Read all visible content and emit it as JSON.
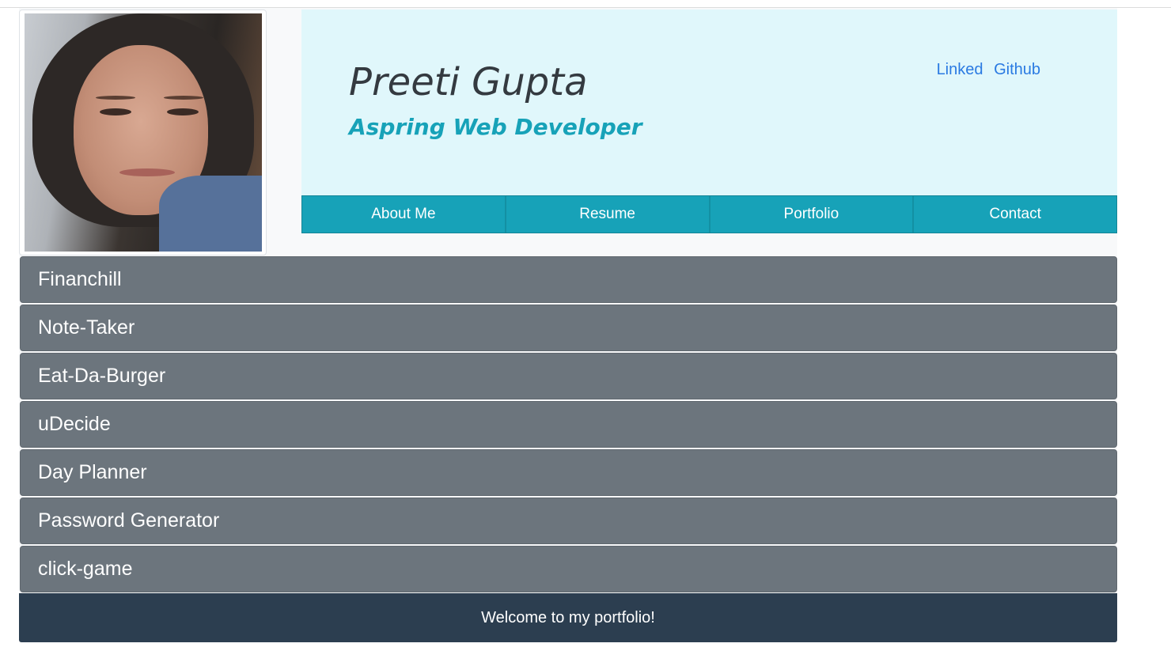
{
  "profile": {
    "name": "Preeti Gupta",
    "tagline": "Aspring Web Developer",
    "photo_alt": "profile-photo"
  },
  "social_links": [
    {
      "label": "Linked"
    },
    {
      "label": "Github"
    }
  ],
  "nav": {
    "items": [
      {
        "label": "About Me"
      },
      {
        "label": "Resume"
      },
      {
        "label": "Portfolio"
      },
      {
        "label": "Contact"
      }
    ]
  },
  "projects": [
    {
      "title": "Financhill"
    },
    {
      "title": "Note-Taker"
    },
    {
      "title": "Eat-Da-Burger"
    },
    {
      "title": "uDecide"
    },
    {
      "title": "Day Planner"
    },
    {
      "title": "Password Generator"
    },
    {
      "title": "click-game"
    }
  ],
  "footer": {
    "text": "Welcome to my portfolio!"
  },
  "colors": {
    "header_bg": "#e0f7fb",
    "accent": "#17a2b8",
    "project_bg": "#6c757d",
    "footer_bg": "#2c3e50",
    "link": "#2a7ae2"
  }
}
